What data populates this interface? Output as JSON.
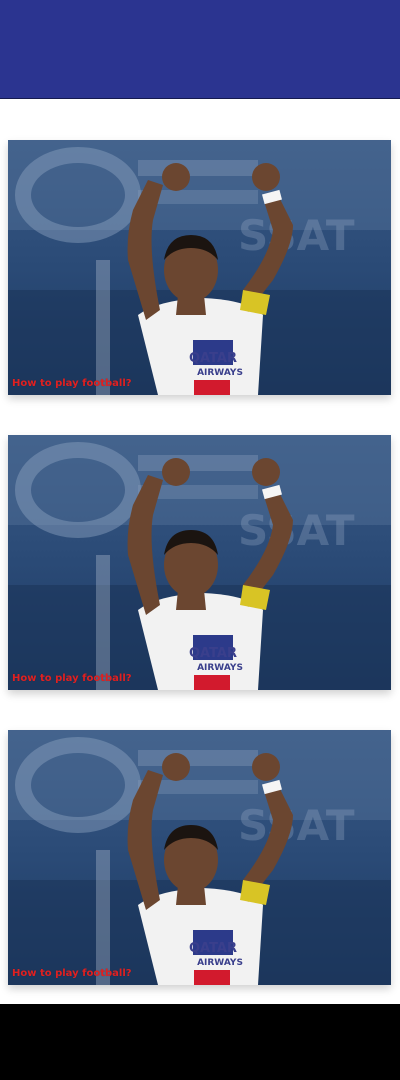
{
  "header": {
    "background_color": "#2b3490"
  },
  "feed": {
    "cards": [
      {
        "caption": "How to play football?",
        "image_icon": "football-player-celebrating-image"
      },
      {
        "caption": "How to play football?",
        "image_icon": "football-player-celebrating-image"
      },
      {
        "caption": "How to play football?",
        "image_icon": "football-player-celebrating-image"
      }
    ],
    "caption_color": "#e02020"
  },
  "footer": {
    "background_color": "#000000"
  }
}
